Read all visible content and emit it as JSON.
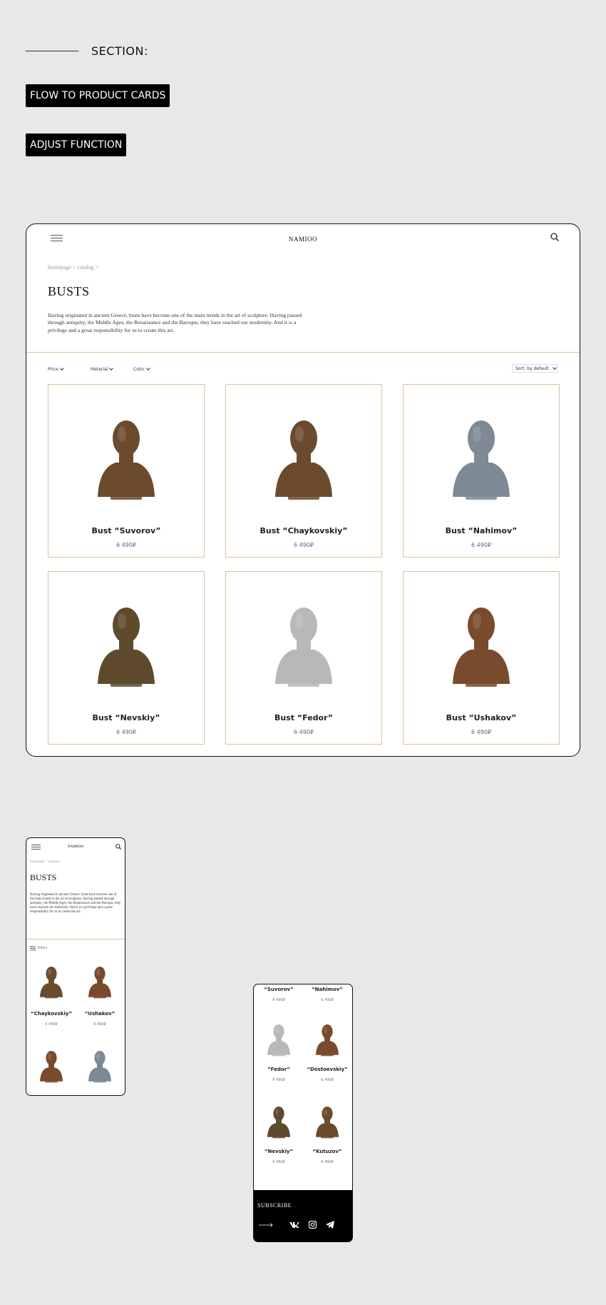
{
  "header": {
    "section_label": "SECTION:",
    "tag1": "FLOW TO PRODUCT CARDS",
    "tag2": "ADJUST FUNCTION"
  },
  "desktop": {
    "logo": "NAMIOO",
    "breadcrumb": "homepage > catalog >",
    "title": "BUSTS",
    "description": "Having originated in ancient Greece, busts have become one of the main trends in the art of sculpture. Having passed through antiquity, the Middle Ages, the Renaissance and the Baroque, they have reached our modernity. And it is a privilege and a great responsibility for us to create this art.",
    "filters": [
      "Price",
      "Material",
      "Color"
    ],
    "sort_label": "Sort: by default",
    "products": [
      {
        "name": "Bust “Suvorov”",
        "price": "6 490₽",
        "tone": "bronze"
      },
      {
        "name": "Bust “Chaykovskiy”",
        "price": "6 490₽",
        "tone": "bronze"
      },
      {
        "name": "Bust “Nahimov”",
        "price": "6 490₽",
        "tone": "blue"
      },
      {
        "name": "Bust “Nevskiy”",
        "price": "6 490₽",
        "tone": "gold"
      },
      {
        "name": "Bust “Fedor”",
        "price": "6 490₽",
        "tone": "grey"
      },
      {
        "name": "Bust “Ushakov”",
        "price": "6 490₽",
        "tone": "copper"
      }
    ]
  },
  "mobile1": {
    "logo": "NAMIOO",
    "breadcrumb": "homepage > catalog >",
    "title": "BUSTS",
    "description": "Having originated in ancient Greece, busts have become one of the main trends in the art of sculpture. Having passed through antiquity, the Middle Ages, the Renaissance and the Baroque, they have reached our modernity. And it is a privilege and a great responsibility for us to create this art.",
    "filters_label": "Filters",
    "products": [
      {
        "name": "“Chaykovskiy”",
        "price": "6 490₽",
        "tone": "bronze"
      },
      {
        "name": "“Ushakov”",
        "price": "6 490₽",
        "tone": "copper"
      },
      {
        "name": "",
        "price": "",
        "tone": "copper"
      },
      {
        "name": "",
        "price": "",
        "tone": "blue"
      }
    ]
  },
  "mobile2": {
    "products": [
      {
        "name": "“Suvorov”",
        "price": "6 490₽"
      },
      {
        "name": "“Nahimov”",
        "price": "6 490₽"
      },
      {
        "name": "“Fedor”",
        "price": "6 490₽",
        "tone": "grey"
      },
      {
        "name": "“Dostoevskiy”",
        "price": "6 490₽",
        "tone": "copper"
      },
      {
        "name": "“Nevskiy”",
        "price": "6 490₽",
        "tone": "gold"
      },
      {
        "name": "“Kutuzov”",
        "price": "6 490₽",
        "tone": "bronze"
      }
    ],
    "subscribe": "SUBSCRIBE",
    "social_icons": [
      "vk-icon",
      "instagram-icon",
      "telegram-icon"
    ]
  },
  "colors": {
    "accent_border": "#e4bf9a",
    "bronze": "#6b4a2e",
    "copper": "#7a4a2c",
    "gold": "#5e4a2c",
    "blue": "#7d8a95",
    "grey": "#b7b9b6"
  }
}
